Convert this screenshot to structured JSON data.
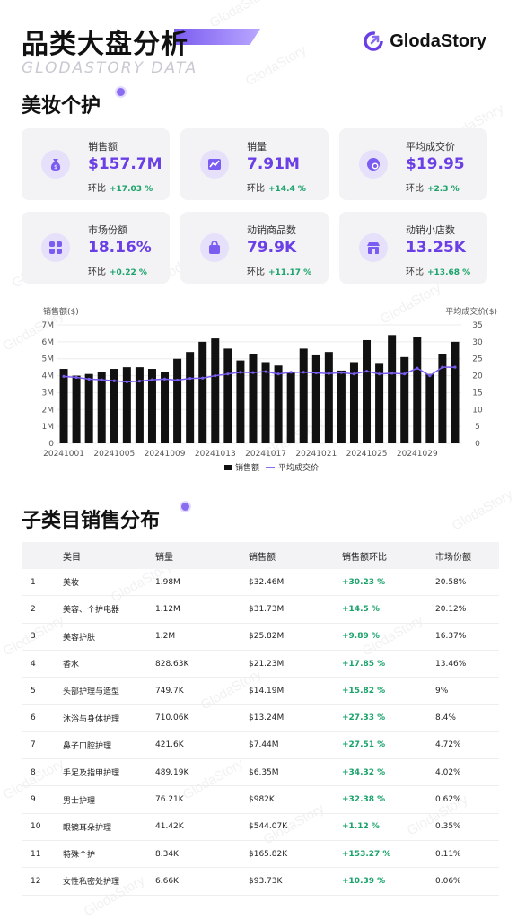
{
  "header": {
    "title": "品类大盘分析",
    "subtitle": "GLODASTORY DATA",
    "brand": "GlodaStory"
  },
  "section1": {
    "title": "美妆个护"
  },
  "metrics": [
    {
      "label": "销售额",
      "value": "$157.7M",
      "delta_label": "环比",
      "delta": "+17.03 %",
      "icon": "money-bag-icon"
    },
    {
      "label": "销量",
      "value": "7.91M",
      "delta_label": "环比",
      "delta": "+14.4 %",
      "icon": "trend-chart-icon"
    },
    {
      "label": "平均成交价",
      "value": "$19.95",
      "delta_label": "环比",
      "delta": "+2.3 %",
      "icon": "price-tag-icon"
    },
    {
      "label": "市场份额",
      "value": "18.16%",
      "delta_label": "环比",
      "delta": "+0.22 %",
      "icon": "grid-icon"
    },
    {
      "label": "动销商品数",
      "value": "79.9K",
      "delta_label": "环比",
      "delta": "+11.17 %",
      "icon": "shopping-bag-icon"
    },
    {
      "label": "动销小店数",
      "value": "13.25K",
      "delta_label": "环比",
      "delta": "+13.68 %",
      "icon": "store-icon"
    }
  ],
  "chart_data": {
    "type": "bar",
    "ylabel": "销售额($)",
    "y2label": "平均成交价($)",
    "ylim": [
      0,
      7
    ],
    "y2lim": [
      0,
      35
    ],
    "y_ticks": [
      "0",
      "1M",
      "2M",
      "3M",
      "4M",
      "5M",
      "6M",
      "7M"
    ],
    "y2_ticks": [
      "0",
      "5",
      "10",
      "15",
      "20",
      "25",
      "30",
      "35"
    ],
    "x_tick_labels": [
      "20241001",
      "20241005",
      "20241009",
      "20241013",
      "20241017",
      "20241021",
      "20241025",
      "20241029"
    ],
    "x_tick_positions": [
      1,
      5,
      9,
      13,
      17,
      21,
      25,
      29
    ],
    "categories": [
      "20241001",
      "20241002",
      "20241003",
      "20241004",
      "20241005",
      "20241006",
      "20241007",
      "20241008",
      "20241009",
      "20241010",
      "20241011",
      "20241012",
      "20241013",
      "20241014",
      "20241015",
      "20241016",
      "20241017",
      "20241018",
      "20241019",
      "20241020",
      "20241021",
      "20241022",
      "20241023",
      "20241024",
      "20241025",
      "20241026",
      "20241027",
      "20241028",
      "20241029",
      "20241030",
      "20241031"
    ],
    "series": [
      {
        "name": "销售额",
        "type": "bar",
        "color": "#111111",
        "values": [
          4.4,
          4.0,
          4.1,
          4.2,
          4.4,
          4.5,
          4.5,
          4.4,
          4.2,
          5.0,
          5.4,
          6.0,
          6.2,
          5.6,
          4.9,
          5.3,
          4.8,
          4.6,
          4.2,
          5.6,
          5.2,
          5.4,
          4.3,
          4.8,
          6.1,
          4.7,
          6.4,
          5.1,
          6.3,
          4.1,
          5.3,
          6.0
        ]
      },
      {
        "name": "平均成交价",
        "type": "line",
        "color": "#7b5cf0",
        "axis": "right",
        "values": [
          19.8,
          19.5,
          19.0,
          18.8,
          18.5,
          18.2,
          18.4,
          18.8,
          19.0,
          18.7,
          19.2,
          19.3,
          20.0,
          20.5,
          21.0,
          20.9,
          21.2,
          20.5,
          21.0,
          21.0,
          20.8,
          20.6,
          20.9,
          20.5,
          21.3,
          20.5,
          20.7,
          20.5,
          22.2,
          20.0,
          22.5,
          22.5
        ]
      }
    ],
    "legend": "bottom"
  },
  "section2": {
    "title": "子类目销售分布"
  },
  "table": {
    "headers": [
      "",
      "类目",
      "销量",
      "销售额",
      "销售额环比",
      "市场份额"
    ],
    "rows": [
      [
        "1",
        "美妆",
        "1.98M",
        "$32.46M",
        "+30.23 %",
        "20.58%"
      ],
      [
        "2",
        "美容、个护电器",
        "1.12M",
        "$31.73M",
        "+14.5 %",
        "20.12%"
      ],
      [
        "3",
        "美容护肤",
        "1.2M",
        "$25.82M",
        "+9.89 %",
        "16.37%"
      ],
      [
        "4",
        "香水",
        "828.63K",
        "$21.23M",
        "+17.85 %",
        "13.46%"
      ],
      [
        "5",
        "头部护理与造型",
        "749.7K",
        "$14.19M",
        "+15.82 %",
        "9%"
      ],
      [
        "6",
        "沐浴与身体护理",
        "710.06K",
        "$13.24M",
        "+27.33 %",
        "8.4%"
      ],
      [
        "7",
        "鼻子口腔护理",
        "421.6K",
        "$7.44M",
        "+27.51 %",
        "4.72%"
      ],
      [
        "8",
        "手足及指甲护理",
        "489.19K",
        "$6.35M",
        "+34.32 %",
        "4.02%"
      ],
      [
        "9",
        "男士护理",
        "76.21K",
        "$982K",
        "+32.38 %",
        "0.62%"
      ],
      [
        "10",
        "眼镜耳朵护理",
        "41.42K",
        "$544.07K",
        "+1.12 %",
        "0.35%"
      ],
      [
        "11",
        "特殊个护",
        "8.34K",
        "$165.82K",
        "+153.27 %",
        "0.11%"
      ],
      [
        "12",
        "女性私密处护理",
        "6.66K",
        "$93.73K",
        "+10.39 %",
        "0.06%"
      ]
    ]
  },
  "colors": {
    "accent": "#6a3fe6",
    "positive": "#1aa36a",
    "bar": "#111111",
    "line": "#7b5cf0"
  }
}
